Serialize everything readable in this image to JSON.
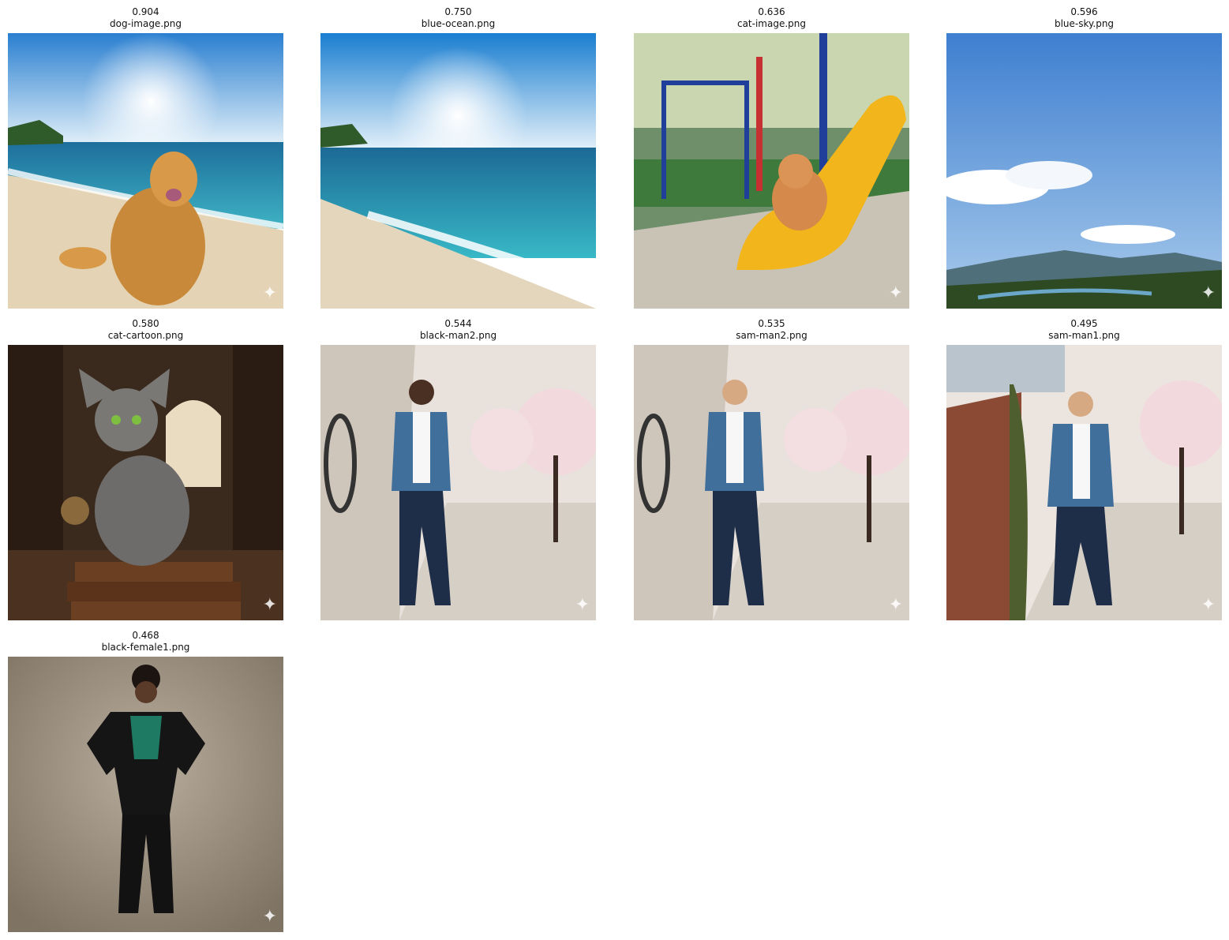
{
  "results": [
    {
      "score": "0.904",
      "filename": "dog-image.png",
      "icon": "sparkle-icon"
    },
    {
      "score": "0.750",
      "filename": "blue-ocean.png",
      "icon": "sparkle-icon"
    },
    {
      "score": "0.636",
      "filename": "cat-image.png",
      "icon": "sparkle-icon"
    },
    {
      "score": "0.596",
      "filename": "blue-sky.png",
      "icon": "sparkle-icon"
    },
    {
      "score": "0.580",
      "filename": "cat-cartoon.png",
      "icon": "sparkle-icon"
    },
    {
      "score": "0.544",
      "filename": "black-man2.png",
      "icon": "sparkle-icon"
    },
    {
      "score": "0.535",
      "filename": "sam-man2.png",
      "icon": "sparkle-icon"
    },
    {
      "score": "0.495",
      "filename": "sam-man1.png",
      "icon": "sparkle-icon"
    },
    {
      "score": "0.468",
      "filename": "black-female1.png",
      "icon": "sparkle-icon"
    }
  ],
  "sparkle_glyph": "✦"
}
